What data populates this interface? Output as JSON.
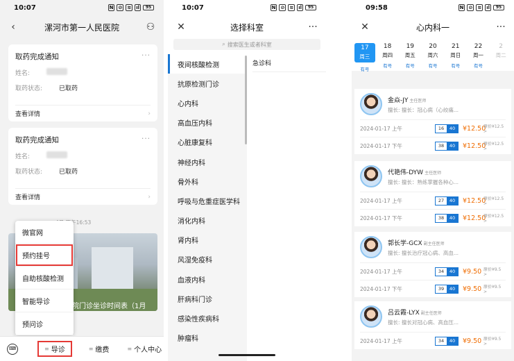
{
  "panel1": {
    "status": {
      "time": "10:07",
      "battery": "95"
    },
    "hospital_title": "漯河市第一人民医院",
    "cards": [
      {
        "title": "取药完成通知",
        "name_label": "姓名:",
        "status_label": "取药状态:",
        "status_value": "已取药",
        "link": "查看详情"
      },
      {
        "title": "取药完成通知",
        "name_label": "姓名:",
        "status_label": "取药状态:",
        "status_value": "已取药",
        "link": "查看详情"
      }
    ],
    "timestamp": "4日 下午16:53",
    "news_caption": "医院门诊坐诊时间表（1月",
    "popup_menu": [
      "微官网",
      "预约挂号",
      "自助核酸检测",
      "智能导诊",
      "预问诊"
    ],
    "tabs": {
      "guide": "导诊",
      "pay": "缴费",
      "personal": "个人中心"
    },
    "colors": {
      "highlight": "#e53935"
    }
  },
  "panel2": {
    "status": {
      "time": "10:07",
      "battery": "95"
    },
    "title": "选择科室",
    "search_placeholder": "搜索医生或者科室",
    "departments": [
      "夜间核酸检测",
      "抗原检测门诊",
      "心内科",
      "高血压内科",
      "心脏康复科",
      "神经内科",
      "骨外科",
      "呼吸与危重症医学科",
      "消化内科",
      "肾内科",
      "风湿免疫科",
      "血液内科",
      "肝病科门诊",
      "感染性疾病科",
      "肿瘤科"
    ],
    "sub_departments": [
      "急诊科"
    ],
    "colors": {
      "active": "#1976d2"
    }
  },
  "panel3": {
    "status": {
      "time": "09:58",
      "battery": "95"
    },
    "title": "心内科一",
    "dates": [
      {
        "day": "17",
        "week": "周三",
        "avail": "有号"
      },
      {
        "day": "18",
        "week": "周四",
        "avail": "有号"
      },
      {
        "day": "19",
        "week": "周五",
        "avail": "有号"
      },
      {
        "day": "20",
        "week": "周六",
        "avail": "有号"
      },
      {
        "day": "21",
        "week": "周日",
        "avail": "有号"
      },
      {
        "day": "22",
        "week": "周一",
        "avail": "有号"
      },
      {
        "day": "2",
        "week": "周二",
        "avail": ""
      }
    ],
    "doctors": [
      {
        "name": "金焱-JY",
        "level": "主任医师",
        "spec": "擅长: 擅长：冠心病（心绞痛...",
        "slots": [
          {
            "time": "2024-01-17 上午",
            "left": "16",
            "total": "40",
            "price": "¥12.50",
            "orig": "原价¥12.5 >"
          },
          {
            "time": "2024-01-17 下午",
            "left": "38",
            "total": "40",
            "price": "¥12.50",
            "orig": "原价¥12.5 >"
          }
        ]
      },
      {
        "name": "代艳伟-DYW",
        "level": "主任医师",
        "spec": "擅长: 擅长：熟练掌握各种心...",
        "slots": [
          {
            "time": "2024-01-17 上午",
            "left": "27",
            "total": "40",
            "price": "¥12.50",
            "orig": "原价¥12.5 >"
          },
          {
            "time": "2024-01-17 下午",
            "left": "38",
            "total": "40",
            "price": "¥12.50",
            "orig": "原价¥12.5 >"
          }
        ]
      },
      {
        "name": "郭长学-GCX",
        "level": "副主任医师",
        "spec": "擅长: 擅长治疗冠心病、高血...",
        "slots": [
          {
            "time": "2024-01-17 上午",
            "left": "34",
            "total": "40",
            "price": "¥9.50",
            "orig": "原价¥9.5 >"
          },
          {
            "time": "2024-01-17 下午",
            "left": "39",
            "total": "40",
            "price": "¥9.50",
            "orig": "原价¥9.5 >"
          }
        ]
      },
      {
        "name": "吕云霞-LYX",
        "level": "副主任医师",
        "spec": "擅长: 擅长对冠心病、高血压...",
        "slots": [
          {
            "time": "2024-01-17 上午",
            "left": "34",
            "total": "40",
            "price": "¥9.50",
            "orig": "原价¥9.5 >"
          }
        ]
      }
    ],
    "colors": {
      "accent": "#2196f3",
      "price": "#ef6c00"
    }
  }
}
